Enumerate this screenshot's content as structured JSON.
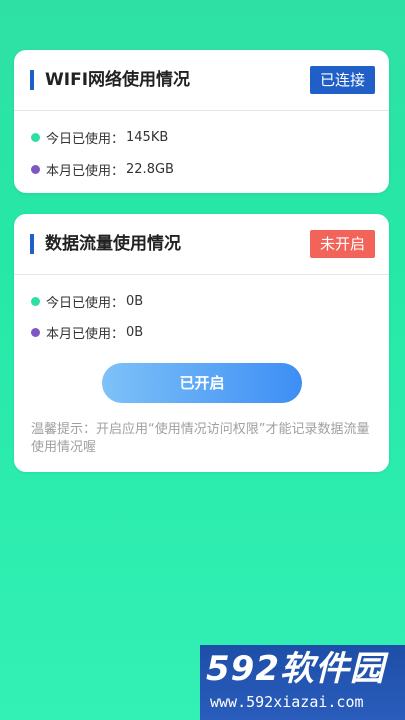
{
  "wifi_card": {
    "title": "WIFI网络使用情况",
    "badge": "已连接",
    "today_label": "今日已使用：",
    "today_value": "145KB",
    "month_label": "本月已使用：",
    "month_value": "22.8GB"
  },
  "data_card": {
    "title": "数据流量使用情况",
    "badge": "未开启",
    "today_label": "今日已使用：",
    "today_value": "0B",
    "month_label": "本月已使用：",
    "month_value": "0B",
    "button_label": "已开启",
    "tip": "温馨提示：开启应用“使用情况访问权限”才能记录数据流量使用情况喔"
  },
  "watermark": {
    "brand": "592软件园",
    "url": "www.592xiazai.com"
  },
  "colors": {
    "background": "#2fe0a4",
    "accent_blue": "#1f5fc7",
    "badge_red": "#f2645a",
    "dot_green": "#2ee0a0",
    "dot_purple": "#7e57c2"
  }
}
